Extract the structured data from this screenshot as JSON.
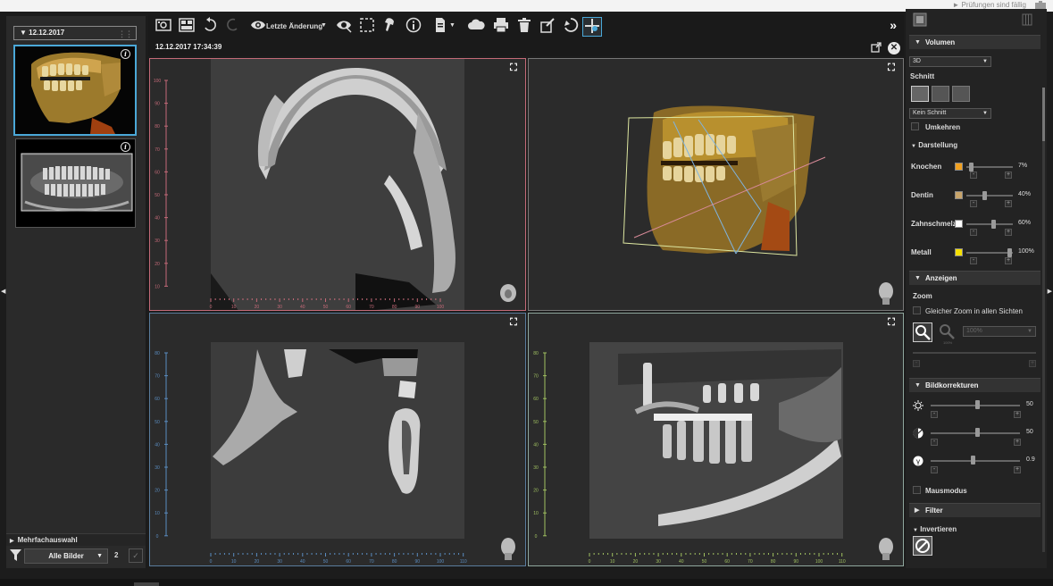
{
  "top": {
    "status_text": "► Prüfungen sind fällig"
  },
  "left_panel": {
    "date_header": "▼   12.12.2017",
    "multi_select_label": "Mehrfachauswahl",
    "filter_value": "Alle Bilder",
    "count": "2"
  },
  "toolbar": {
    "undo_label": "Letzte Änderung",
    "collapse": "»"
  },
  "viewer": {
    "timestamp": "12.12.2017 17:34:39"
  },
  "rulers": {
    "v1_x": [
      "0",
      "10",
      "20",
      "30",
      "40",
      "50",
      "60",
      "70",
      "80",
      "90",
      "100"
    ],
    "v1_y": [
      "100",
      "90",
      "80",
      "70",
      "60",
      "50",
      "40",
      "30",
      "20",
      "10"
    ],
    "v3_x": [
      "0",
      "10",
      "20",
      "30",
      "40",
      "50",
      "60",
      "70",
      "80",
      "90",
      "100",
      "110"
    ],
    "v3_y": [
      "80",
      "70",
      "60",
      "50",
      "40",
      "30",
      "20",
      "10",
      "0"
    ],
    "v4_x": [
      "0",
      "10",
      "20",
      "30",
      "40",
      "50",
      "60",
      "70",
      "80",
      "90",
      "100",
      "110"
    ],
    "v4_y": [
      "80",
      "70",
      "60",
      "50",
      "40",
      "30",
      "20",
      "10",
      "0"
    ]
  },
  "right_panel": {
    "volume_header": "Volumen",
    "mode_select": "3D",
    "section_label": "Schnitt",
    "section_select": "Kein Schnitt",
    "invert_label": "Umkehren",
    "display_header": "Darstellung",
    "materials": [
      {
        "label": "Knochen",
        "color": "#f0a020",
        "value": "7%",
        "level": 0.07
      },
      {
        "label": "Dentin",
        "color": "#c8a46a",
        "value": "40%",
        "level": 0.4
      },
      {
        "label": "Zahnschmelz",
        "color": "#ffffff",
        "value": "60%",
        "level": 0.6
      },
      {
        "label": "Metall",
        "color": "#f6e000",
        "value": "100%",
        "level": 1.0
      }
    ],
    "show_header": "Anzeigen",
    "zoom_label": "Zoom",
    "same_zoom_label": "Gleicher Zoom in allen Sichten",
    "zoom_value": "100%",
    "zoom_sub": "100%",
    "corrections_header": "Bildkorrekturen",
    "corrections": [
      {
        "name": "brightness",
        "value": "50",
        "level": 0.5
      },
      {
        "name": "contrast",
        "value": "50",
        "level": 0.5
      },
      {
        "name": "gamma",
        "value": "0.9",
        "level": 0.45
      }
    ],
    "mouse_mode_label": "Mausmodus",
    "filter_header": "Filter",
    "invert_header": "Invertieren",
    "plus": "+",
    "minus": "-"
  }
}
